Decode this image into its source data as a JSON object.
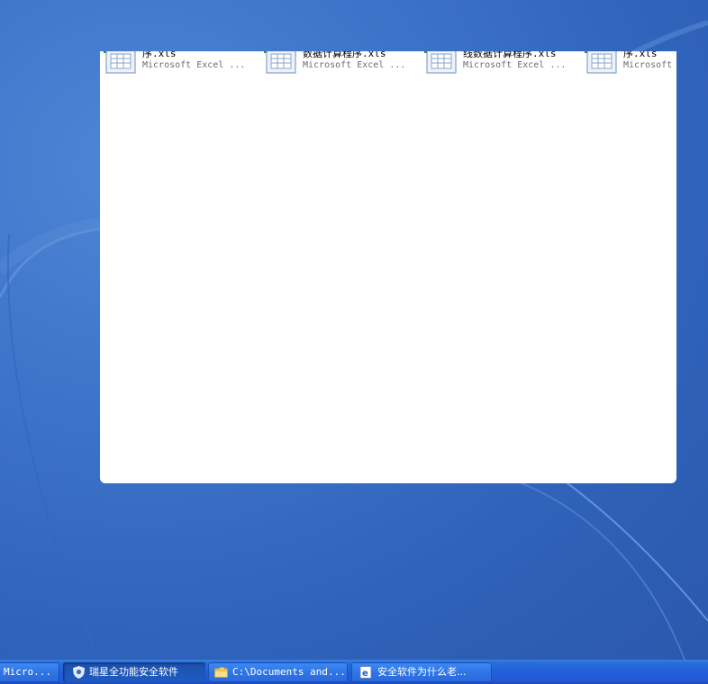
{
  "window": {
    "files": [
      {
        "name": "序.xls",
        "type": "Microsoft Excel ..."
      },
      {
        "name": "数据计算程序.xls",
        "type": "Microsoft Excel ..."
      },
      {
        "name": "线数据计算程序.xls",
        "type": "Microsoft Excel ..."
      },
      {
        "name": "序.xls",
        "type": "Microsoft"
      }
    ]
  },
  "taskbar": {
    "buttons": [
      {
        "label": "Micro...",
        "icon": "excel-icon",
        "active": false
      },
      {
        "label": "瑞星全功能安全软件",
        "icon": "shield-icon",
        "active": true
      },
      {
        "label": "C:\\Documents and...",
        "icon": "folder-icon",
        "active": false
      },
      {
        "label": "安全软件为什么老...",
        "icon": "ie-icon",
        "active": false
      }
    ]
  },
  "colors": {
    "desktop": "#3a6fc4",
    "taskbar": "#245edb",
    "excel_green": "#1f7a3a"
  }
}
